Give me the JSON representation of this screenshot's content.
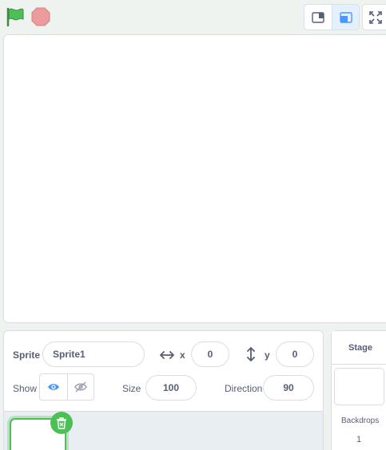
{
  "stage_selector": {
    "title": "Stage",
    "backdrops_label": "Backdrops",
    "backdrops_count": "1"
  },
  "sprite_info": {
    "sprite_label": "Sprite",
    "sprite_name": "Sprite1",
    "x_label": "x",
    "x_value": "0",
    "y_label": "y",
    "y_value": "0",
    "show_label": "Show",
    "size_label": "Size",
    "size_value": "100",
    "direction_label": "Direction",
    "direction_value": "90"
  },
  "colors": {
    "go_flag": "#4cbf56",
    "stop": "#ec9c9c",
    "accent_blue": "#4c97ff",
    "selected_green": "#4cbf56"
  },
  "icons": [
    "green-flag-icon",
    "stop-icon",
    "small-stage-icon",
    "large-stage-icon",
    "fullscreen-icon",
    "x-arrows-icon",
    "y-arrows-icon",
    "eye-icon",
    "eye-slash-icon",
    "trash-icon"
  ]
}
